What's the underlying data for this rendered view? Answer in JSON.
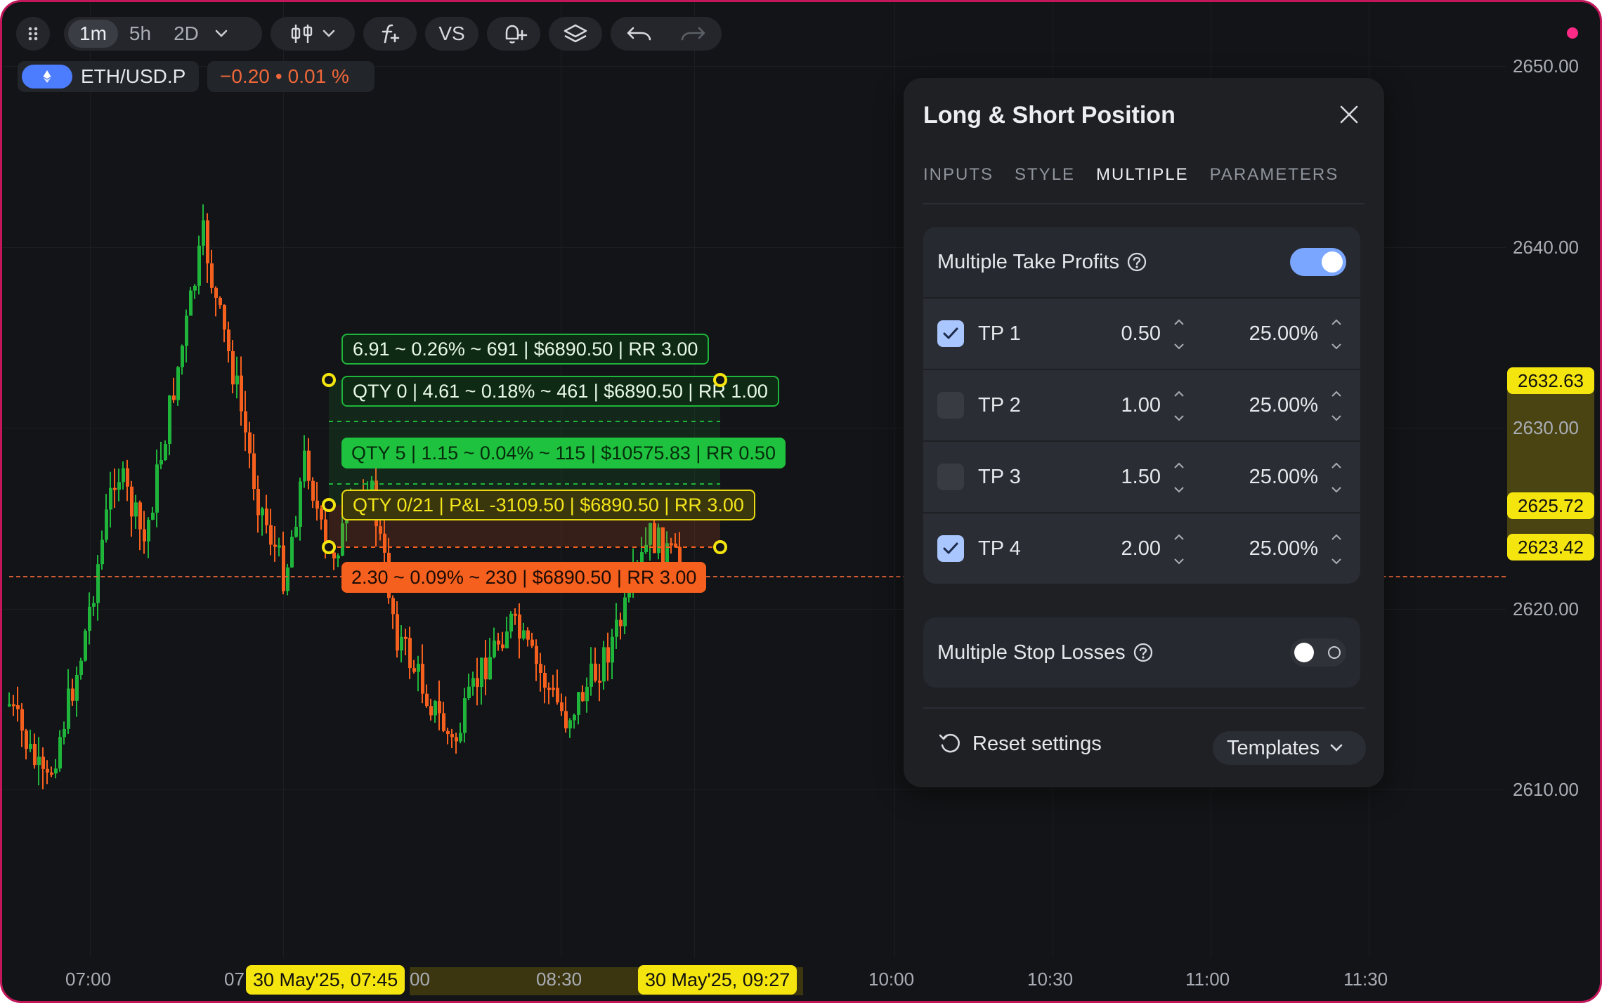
{
  "toolbar": {
    "grid_icon": "grip-icon",
    "intervals": [
      "1m",
      "5h",
      "2D"
    ],
    "active_interval": "1m",
    "chart_type_icon": "candles-icon",
    "indicators_icon": "function-icon",
    "compare_label": "VS",
    "alert_icon": "alert-plus-icon",
    "layers_icon": "layers-icon",
    "undo_icon": "undo-icon",
    "redo_icon": "redo-icon"
  },
  "symbol": {
    "name": "ETH/USD.P",
    "change": "−0.20",
    "separator": "•",
    "change_pct": "0.01 %"
  },
  "price_axis": {
    "labels": [
      "2650.00",
      "2640.00",
      "2630.00",
      "2620.00",
      "2610.00"
    ],
    "tags": [
      "2632.63",
      "2625.72",
      "2623.42"
    ]
  },
  "time_axis": {
    "labels": [
      "07:00",
      "07",
      "00",
      "08:30",
      "10:00",
      "10:30",
      "11:00",
      "11:30"
    ],
    "tags": [
      "30 May'25, 07:45",
      "30 May'25, 09:27"
    ]
  },
  "position_labels": {
    "tp_final": "6.91 ~ 0.26% ~ 691 | $6890.50 | RR 3.00",
    "tp_qty0": "QTY 0 | 4.61 ~ 0.18% ~ 461 | $6890.50 | RR 1.00",
    "tp_qty5": "QTY 5 | 1.15 ~ 0.04% ~ 115 | $10575.83 | RR 0.50",
    "entry": "QTY 0/21 | P&L -3109.50 | $6890.50 | RR 3.00",
    "stop": "2.30 ~ 0.09% ~ 230 | $6890.50 | RR 3.00"
  },
  "panel": {
    "title": "Long & Short Position",
    "tabs": [
      "INPUTS",
      "STYLE",
      "MULTIPLE",
      "PARAMETERS"
    ],
    "active_tab": "MULTIPLE",
    "take_profits": {
      "label": "Multiple Take Profits",
      "enabled": true,
      "rows": [
        {
          "label": "TP 1",
          "value": "0.50",
          "percent": "25.00%",
          "checked": true
        },
        {
          "label": "TP 2",
          "value": "1.00",
          "percent": "25.00%",
          "checked": false
        },
        {
          "label": "TP 3",
          "value": "1.50",
          "percent": "25.00%",
          "checked": false
        },
        {
          "label": "TP 4",
          "value": "2.00",
          "percent": "25.00%",
          "checked": true
        }
      ]
    },
    "stop_losses": {
      "label": "Multiple Stop Losses",
      "enabled": false
    },
    "reset_label": "Reset settings",
    "templates_label": "Templates"
  },
  "colors": {
    "up": "#1fb53b",
    "down": "#f5601e",
    "accent": "#f5e50e",
    "toggle_on": "#7aa6ff",
    "frame": "#c2185b"
  }
}
